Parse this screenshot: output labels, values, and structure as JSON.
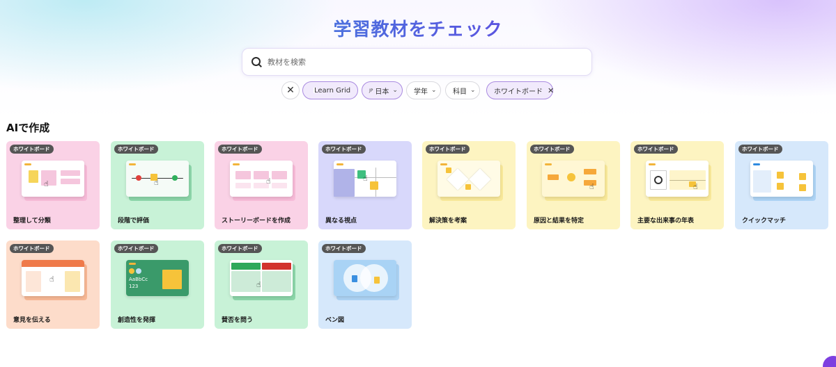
{
  "page_title": "学習教材をチェック",
  "search": {
    "placeholder": "教材を検索"
  },
  "filters": {
    "learn_grid": "Learn Grid",
    "lang_code": "JP",
    "lang": "日本",
    "grade": "学年",
    "subject": "科目",
    "type": "ホワイトボード"
  },
  "section_title": "AIで作成",
  "badge": "ホワイトボード",
  "cards": [
    {
      "title": "整理して分類",
      "color": "#fad2e6"
    },
    {
      "title": "段階で評価",
      "color": "#c8f2d7"
    },
    {
      "title": "ストーリーボードを作成",
      "color": "#fad2e6"
    },
    {
      "title": "異なる視点",
      "color": "#d8d8fb"
    },
    {
      "title": "解決策を考案",
      "color": "#fdf4c1"
    },
    {
      "title": "原因と結果を特定",
      "color": "#fdf4c1"
    },
    {
      "title": "主要な出来事の年表",
      "color": "#fdf4c1"
    },
    {
      "title": "クイックマッチ",
      "color": "#d6e8fb"
    },
    {
      "title": "意見を伝える",
      "color": "#fddcca"
    },
    {
      "title": "創造性を発揮",
      "color": "#c8f2d7"
    },
    {
      "title": "賛否を問う",
      "color": "#c8f2d7"
    },
    {
      "title": "ベン図",
      "color": "#d6e8fb"
    }
  ],
  "swatch_text": "AaBbCc",
  "swatch_num": "123",
  "icons": [
    "search-icon",
    "close-icon",
    "book-icon",
    "chevron-down-icon",
    "pointer-cursor-icon"
  ]
}
